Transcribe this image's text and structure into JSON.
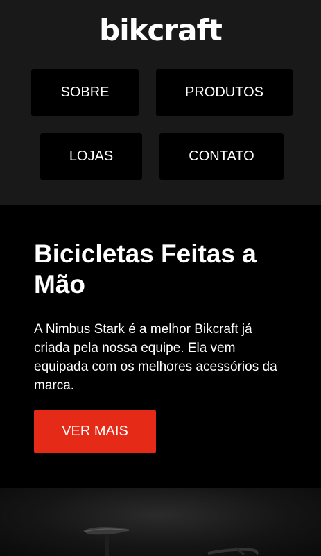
{
  "brand": {
    "logo_text": "bikcraft"
  },
  "nav": {
    "items": [
      {
        "label": "SOBRE"
      },
      {
        "label": "PRODUTOS"
      },
      {
        "label": "LOJAS"
      },
      {
        "label": "CONTATO"
      }
    ]
  },
  "intro": {
    "title": "Bicicletas Feitas a Mão",
    "text": "A Nimbus Stark é a melhor Bikcraft já criada pela nossa equipe. Ela vem equipada com os melhores acessórios da marca.",
    "cta_label": "VER MAIS"
  },
  "colors": {
    "header_bg": "#191919",
    "page_bg": "#000000",
    "accent": "#e52a17"
  }
}
